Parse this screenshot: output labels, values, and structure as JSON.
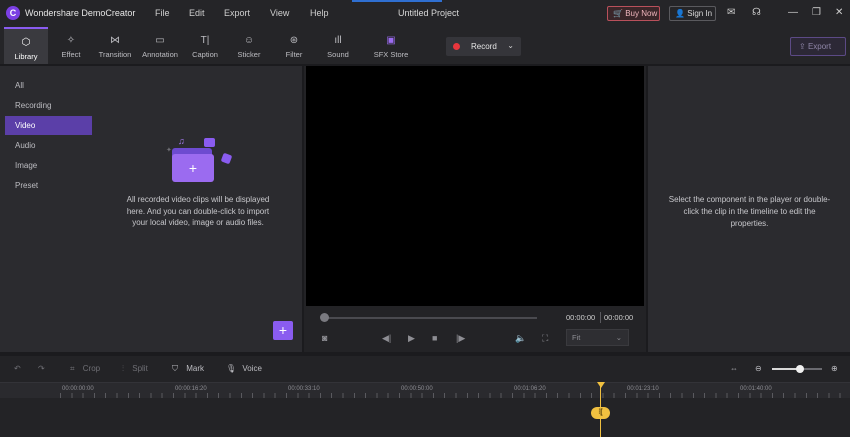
{
  "app": {
    "name": "Wondershare DemoCreator",
    "logo_letter": "C",
    "project_title": "Untitled Project"
  },
  "menu": [
    "File",
    "Edit",
    "Export",
    "View",
    "Help"
  ],
  "title_actions": {
    "buy_now": "Buy Now",
    "sign_in": "Sign In"
  },
  "title_icons": [
    "mail-icon",
    "headset-icon",
    "minimize-icon",
    "restore-icon",
    "close-icon"
  ],
  "toolbar": {
    "tools": [
      {
        "label": "Library",
        "icon": "library-icon"
      },
      {
        "label": "Effect",
        "icon": "effect-icon"
      },
      {
        "label": "Transition",
        "icon": "transition-icon"
      },
      {
        "label": "Annotation",
        "icon": "annotation-icon"
      },
      {
        "label": "Caption",
        "icon": "caption-icon"
      },
      {
        "label": "Sticker",
        "icon": "sticker-icon"
      },
      {
        "label": "Filter",
        "icon": "filter-icon"
      },
      {
        "label": "Sound",
        "icon": "sound-icon"
      },
      {
        "label": "SFX Store",
        "icon": "sfx-store-icon"
      }
    ],
    "active_tool": "Library",
    "record_label": "Record",
    "export_label": "Export"
  },
  "library": {
    "nav": [
      "All",
      "Recording",
      "Video",
      "Audio",
      "Image",
      "Preset"
    ],
    "active_nav": "Video",
    "empty_text": "All recorded video clips will be displayed here. And you can double-click to import your local video, image or audio files."
  },
  "player": {
    "current_time": "00:00:00",
    "total_time": "00:00:00",
    "fit_value": "Fit"
  },
  "properties": {
    "hint": "Select the component in the player or double-click the clip in the timeline to edit the properties."
  },
  "timeline": {
    "tools": {
      "crop": "Crop",
      "split": "Split",
      "mark": "Mark",
      "voice": "Voice"
    },
    "zoom_level": 0.56,
    "ruler": [
      "00:00:00:00",
      "00:00:16:20",
      "00:00:33:10",
      "00:00:50:00",
      "00:01:06:20",
      "00:01:23:10",
      "00:01:40:00"
    ]
  }
}
